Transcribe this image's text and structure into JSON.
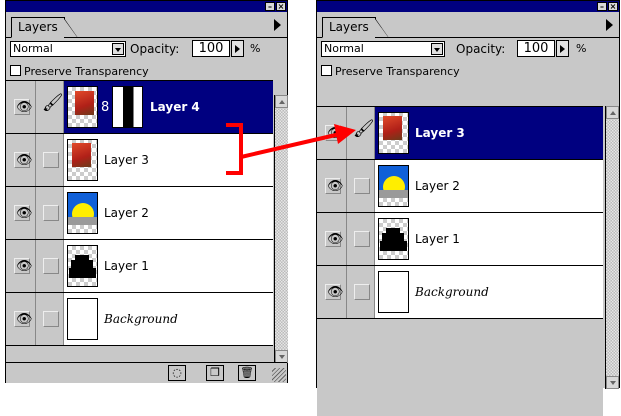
{
  "left_palette": {
    "tab_label": "Layers",
    "mode": "Normal",
    "opacity_label": "Opacity:",
    "opacity_value": "100",
    "opacity_unit": "%",
    "preserve_label": "Preserve Transparency",
    "layers": [
      {
        "name": "Layer 4",
        "selected": true,
        "thumbnail": "red-image-with-mask"
      },
      {
        "name": "Layer 3",
        "selected": false,
        "thumbnail": "red-image"
      },
      {
        "name": "Layer 2",
        "selected": false,
        "thumbnail": "yellow-sun-blue-sky"
      },
      {
        "name": "Layer 1",
        "selected": false,
        "thumbnail": "black-silhouette"
      },
      {
        "name": "Background",
        "selected": false,
        "thumbnail": "white"
      }
    ],
    "bottom_buttons": [
      "mask-icon",
      "new-layer-icon",
      "trash-icon"
    ]
  },
  "right_palette": {
    "tab_label": "Layers",
    "mode": "Normal",
    "opacity_label": "Opacity:",
    "opacity_value": "100",
    "opacity_unit": "%",
    "preserve_label": "Preserve Transparency",
    "layers": [
      {
        "name": "Layer 3",
        "selected": true,
        "thumbnail": "red-image"
      },
      {
        "name": "Layer 2",
        "selected": false,
        "thumbnail": "yellow-sun-blue-sky"
      },
      {
        "name": "Layer 1",
        "selected": false,
        "thumbnail": "black-silhouette"
      },
      {
        "name": "Background",
        "selected": false,
        "thumbnail": "white"
      }
    ]
  },
  "colors": {
    "titlebar": "#000080",
    "selected_row": "#000080",
    "palette_bg": "#c8c8c8",
    "annotation": "#ff0000",
    "sun_yellow": "#ffee00",
    "sky_blue": "#1060d8"
  }
}
